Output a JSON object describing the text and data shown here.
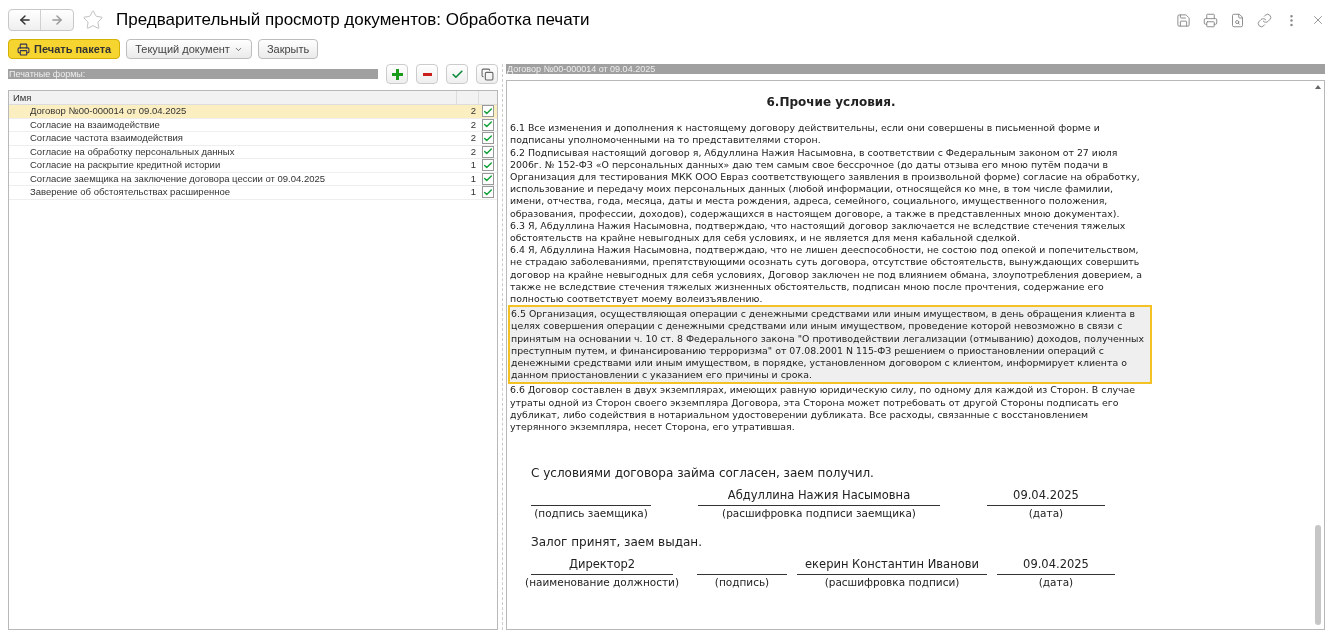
{
  "window": {
    "title": "Предварительный просмотр документов: Обработка печати"
  },
  "command_bar": [
    {
      "label": "Печать пакета",
      "kind": "primary"
    },
    {
      "label": "Текущий документ",
      "kind": "dropdown"
    },
    {
      "label": "Закрыть",
      "kind": "plain"
    }
  ],
  "forms_panel": {
    "header": "Печатные формы:",
    "table": {
      "columns": [
        "Имя"
      ],
      "rows": [
        {
          "name": "Договор №00-000014 от 09.04.2025",
          "copies": "2",
          "checked": true,
          "selected": true
        },
        {
          "name": "Согласие на взаимодействие",
          "copies": "2",
          "checked": true,
          "selected": false
        },
        {
          "name": "Согласие частота взаимодействия",
          "copies": "2",
          "checked": true,
          "selected": false
        },
        {
          "name": "Согласие на обработку персональных данных",
          "copies": "2",
          "checked": true,
          "selected": false
        },
        {
          "name": "Согласие на раскрытие кредитной истории",
          "copies": "1",
          "checked": true,
          "selected": false
        },
        {
          "name": "Согласие заемщика на заключение договора цессии от 09.04.2025",
          "copies": "1",
          "checked": true,
          "selected": false
        },
        {
          "name": "Заверение об обстоятельствах расширенное",
          "copies": "1",
          "checked": true,
          "selected": false
        }
      ]
    }
  },
  "preview": {
    "header": "Договор №00-000014 от 09.04.2025",
    "heading": "6.Прочие условия.",
    "paragraphs": [
      {
        "highlighted": false,
        "lines": [
          "6.1 Все изменения и дополнения к настоящему договору действительны, если они совершены в письменной форме и",
          "подписаны уполномоченными на то представителями сторон.",
          "6.2 Подписывая настоящий договор я, Абдуллина Нажия Насымовна, в соответствии с Федеральным законом от 27 июля",
          "2006г. № 152-ФЗ «О персональных данных» даю тем самым свое бессрочное (до даты отзыва его мною путём подачи в",
          "Организация для тестирования МКК ООО Евраз соответствующего заявления в произвольной форме) согласие на обработку,",
          "использование и передачу моих персональных данных (любой информации, относящейся ко мне, в том числе фамилии,",
          "имени, отчества, года, месяца, даты и места рождения, адреса, семейного, социального, имущественного положения,",
          "образования, профессии, доходов), содержащихся в настоящем договоре, а также в представленных мною документах).",
          "6.3 Я, Абдуллина Нажия Насымовна, подтверждаю, что настоящий договор заключается не вследствие стечения тяжелых",
          "обстоятельств на крайне невыгодных для себя условиях, и не является для меня кабальной сделкой.",
          "6.4 Я, Абдуллина Нажия Насымовна, подтверждаю, что не лишен дееспособности, не состою под опекой и попечительством,",
          "не страдаю заболеваниями, препятствующими осознать суть договора, отсутствие обстоятельств, вынуждающих совершить",
          "договор на крайне невыгодных для себя условиях, Договор заключен не под влиянием обмана, злоупотребления доверием, а",
          "также не вследствие стечения тяжелых жизненных обстоятельств, подписан мною после прочтения, содержание его",
          "полностью соответствует моему волеизъявлению."
        ]
      },
      {
        "highlighted": true,
        "lines": [
          "6.5 Организация, осуществляющая операции с денежными средствами или иным имуществом, в день обращения клиента в",
          "целях совершения операции с денежными средствами или иным имуществом, проведение которой невозможно в связи с",
          "принятым на основании ч. 10 ст. 8 Федерального закона \"О противодействии легализации (отмыванию) доходов, полученных",
          "преступным путем, и финансированию терроризма\" от 07.08.2001 N 115-ФЗ  решением о приостановлении операций с",
          "денежными средствами или иным имуществом, в порядке, установленном договором с клиентом, информирует клиента о",
          "данном приостановлении с указанием его причины и срока."
        ]
      },
      {
        "highlighted": false,
        "lines": [
          "6.6 Договор составлен в двух экземплярах, имеющих равную юридическую силу, по одному для каждой из Сторон. В случае",
          "утраты одной из Сторон своего экземпляра Договора, эта Сторона может потребовать от другой Стороны подписать его",
          "дубликат, либо содействия в нотариальном удостоверении дубликата. Все расходы, связанные с восстановлением",
          "утерянного экземпляра, несет Сторона, его утратившая."
        ]
      }
    ],
    "signature_blocks": [
      {
        "statement": "С условиями договора займа согласен, заем получил.",
        "fields": [
          {
            "caption": "(подпись заемщика)"
          },
          {
            "value": "Абдуллина Нажия Насымовна",
            "caption": "(расшифровка подписи заемщика)"
          },
          {
            "value": "09.04.2025",
            "caption": "(дата)"
          }
        ]
      },
      {
        "statement": "Залог принят, заем выдан.",
        "fields": [
          {
            "value": "Директор2",
            "caption": "(наименование должности)"
          },
          {
            "caption": "(подпись)"
          },
          {
            "value": "екерин Константин Иванови",
            "caption": "(расшифровка подписи)"
          },
          {
            "value": "09.04.2025",
            "caption": "(дата)"
          }
        ]
      }
    ]
  }
}
